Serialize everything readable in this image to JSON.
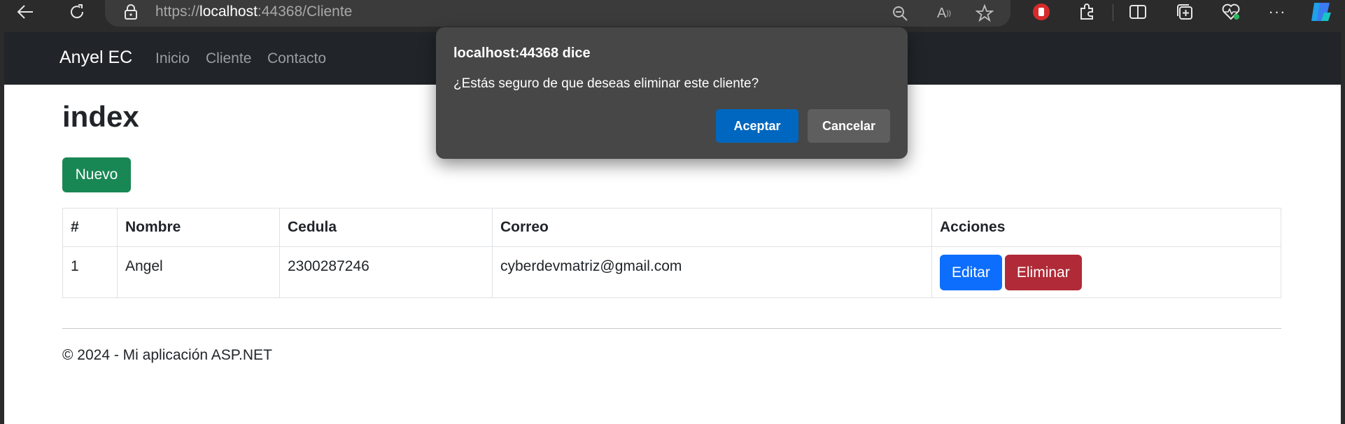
{
  "browser": {
    "url_prefix": "https://",
    "url_host": "localhost",
    "url_rest": ":44368/Cliente",
    "icons": [
      "back-icon",
      "refresh-icon",
      "lock-icon",
      "zoom-out-icon",
      "read-aloud-icon",
      "favorite-star-icon",
      "block-extension-icon",
      "extensions-icon",
      "split-screen-icon",
      "collections-icon",
      "health-icon",
      "more-icon",
      "copilot-icon"
    ]
  },
  "navbar": {
    "brand": "Anyel EC",
    "links": [
      "Inicio",
      "Cliente",
      "Contacto"
    ]
  },
  "main": {
    "title": "index",
    "new_button": "Nuevo",
    "table": {
      "headers": [
        "#",
        "Nombre",
        "Cedula",
        "Correo",
        "Acciones"
      ],
      "rows": [
        {
          "id": "1",
          "nombre": "Angel",
          "cedula": "2300287246",
          "correo": "cyberdevmatriz@gmail.com"
        }
      ],
      "edit_label": "Editar",
      "delete_label": "Eliminar"
    }
  },
  "footer": {
    "text": "© 2024 - Mi aplicación ASP.NET"
  },
  "dialog": {
    "title": "localhost:44368 dice",
    "message": "¿Estás seguro de que deseas eliminar este cliente?",
    "accept": "Aceptar",
    "cancel": "Cancelar"
  },
  "colors": {
    "navbar_bg": "#212529",
    "success": "#198754",
    "primary": "#0d6efd",
    "danger": "#b02a37",
    "dialog_bg": "#474747",
    "dialog_accept": "#0067c0"
  }
}
